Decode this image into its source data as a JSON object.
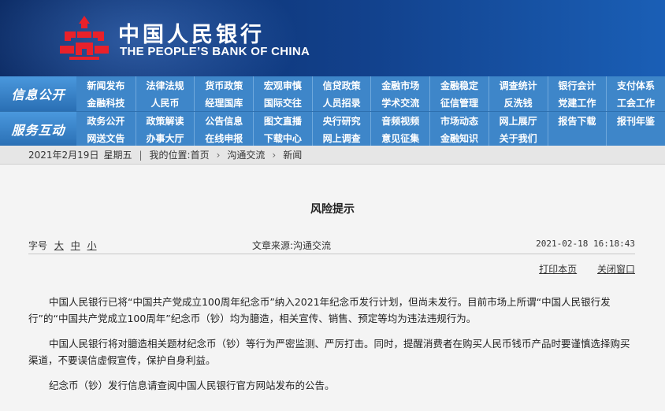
{
  "header": {
    "logo": "pboc-emblem",
    "cn_name": "中国人民银行",
    "en_name": "THE PEOPLE’S BANK OF CHINA",
    "colors": {
      "banner_dark": "#0b2a63",
      "banner_light": "#1a5fb6",
      "emblem_red": "#e8212a"
    }
  },
  "nav": {
    "colors": {
      "bar": "#3e86c9",
      "text": "#ffffff"
    },
    "groups": [
      {
        "label": "信息公开",
        "rows": [
          [
            "新闻发布",
            "法律法规",
            "货币政策",
            "宏观审慎",
            "信贷政策",
            "金融市场",
            "金融稳定",
            "调查统计",
            "银行会计",
            "支付体系"
          ],
          [
            "金融科技",
            "人民币",
            "经理国库",
            "国际交往",
            "人员招录",
            "学术交流",
            "征信管理",
            "反洗钱",
            "党建工作",
            "工会工作"
          ]
        ]
      },
      {
        "label": "服务互动",
        "rows": [
          [
            "政务公开",
            "政策解读",
            "公告信息",
            "图文直播",
            "央行研究",
            "音频视频",
            "市场动态",
            "网上展厅",
            "报告下载",
            "报刊年鉴"
          ],
          [
            "网送文告",
            "办事大厅",
            "在线申报",
            "下载中心",
            "网上调查",
            "意见征集",
            "金融知识",
            "关于我们",
            "",
            ""
          ]
        ]
      }
    ]
  },
  "breadcrumb": {
    "date": "2021年2月19日",
    "weekday": "星期五",
    "location_label": "我的位置:",
    "home": "首页",
    "section": "沟通交流",
    "current": "新闻"
  },
  "article": {
    "title": "风险提示",
    "font_size_label": "字号",
    "font_sizes": [
      "大",
      "中",
      "小"
    ],
    "source": "文章来源:沟通交流",
    "datetime": "2021-02-18 16:18:43",
    "print_label": "打印本页",
    "close_label": "关闭窗口",
    "paragraphs": [
      "中国人民银行已将“中国共产党成立100周年纪念币”纳入2021年纪念币发行计划，但尚未发行。目前市场上所谓“中国人民银行发行”的“中国共产党成立100周年”纪念币（钞）均为臆造，相关宣传、销售、预定等均为违法违规行为。",
      "中国人民银行将对臆造相关题材纪念币（钞）等行为严密监测、严厉打击。同时，提醒消费者在购买人民币钱币产品时要谨慎选择购买渠道，不要误信虚假宣传，保护自身利益。",
      "纪念币（钞）发行信息请查阅中国人民银行官方网站发布的公告。"
    ]
  }
}
